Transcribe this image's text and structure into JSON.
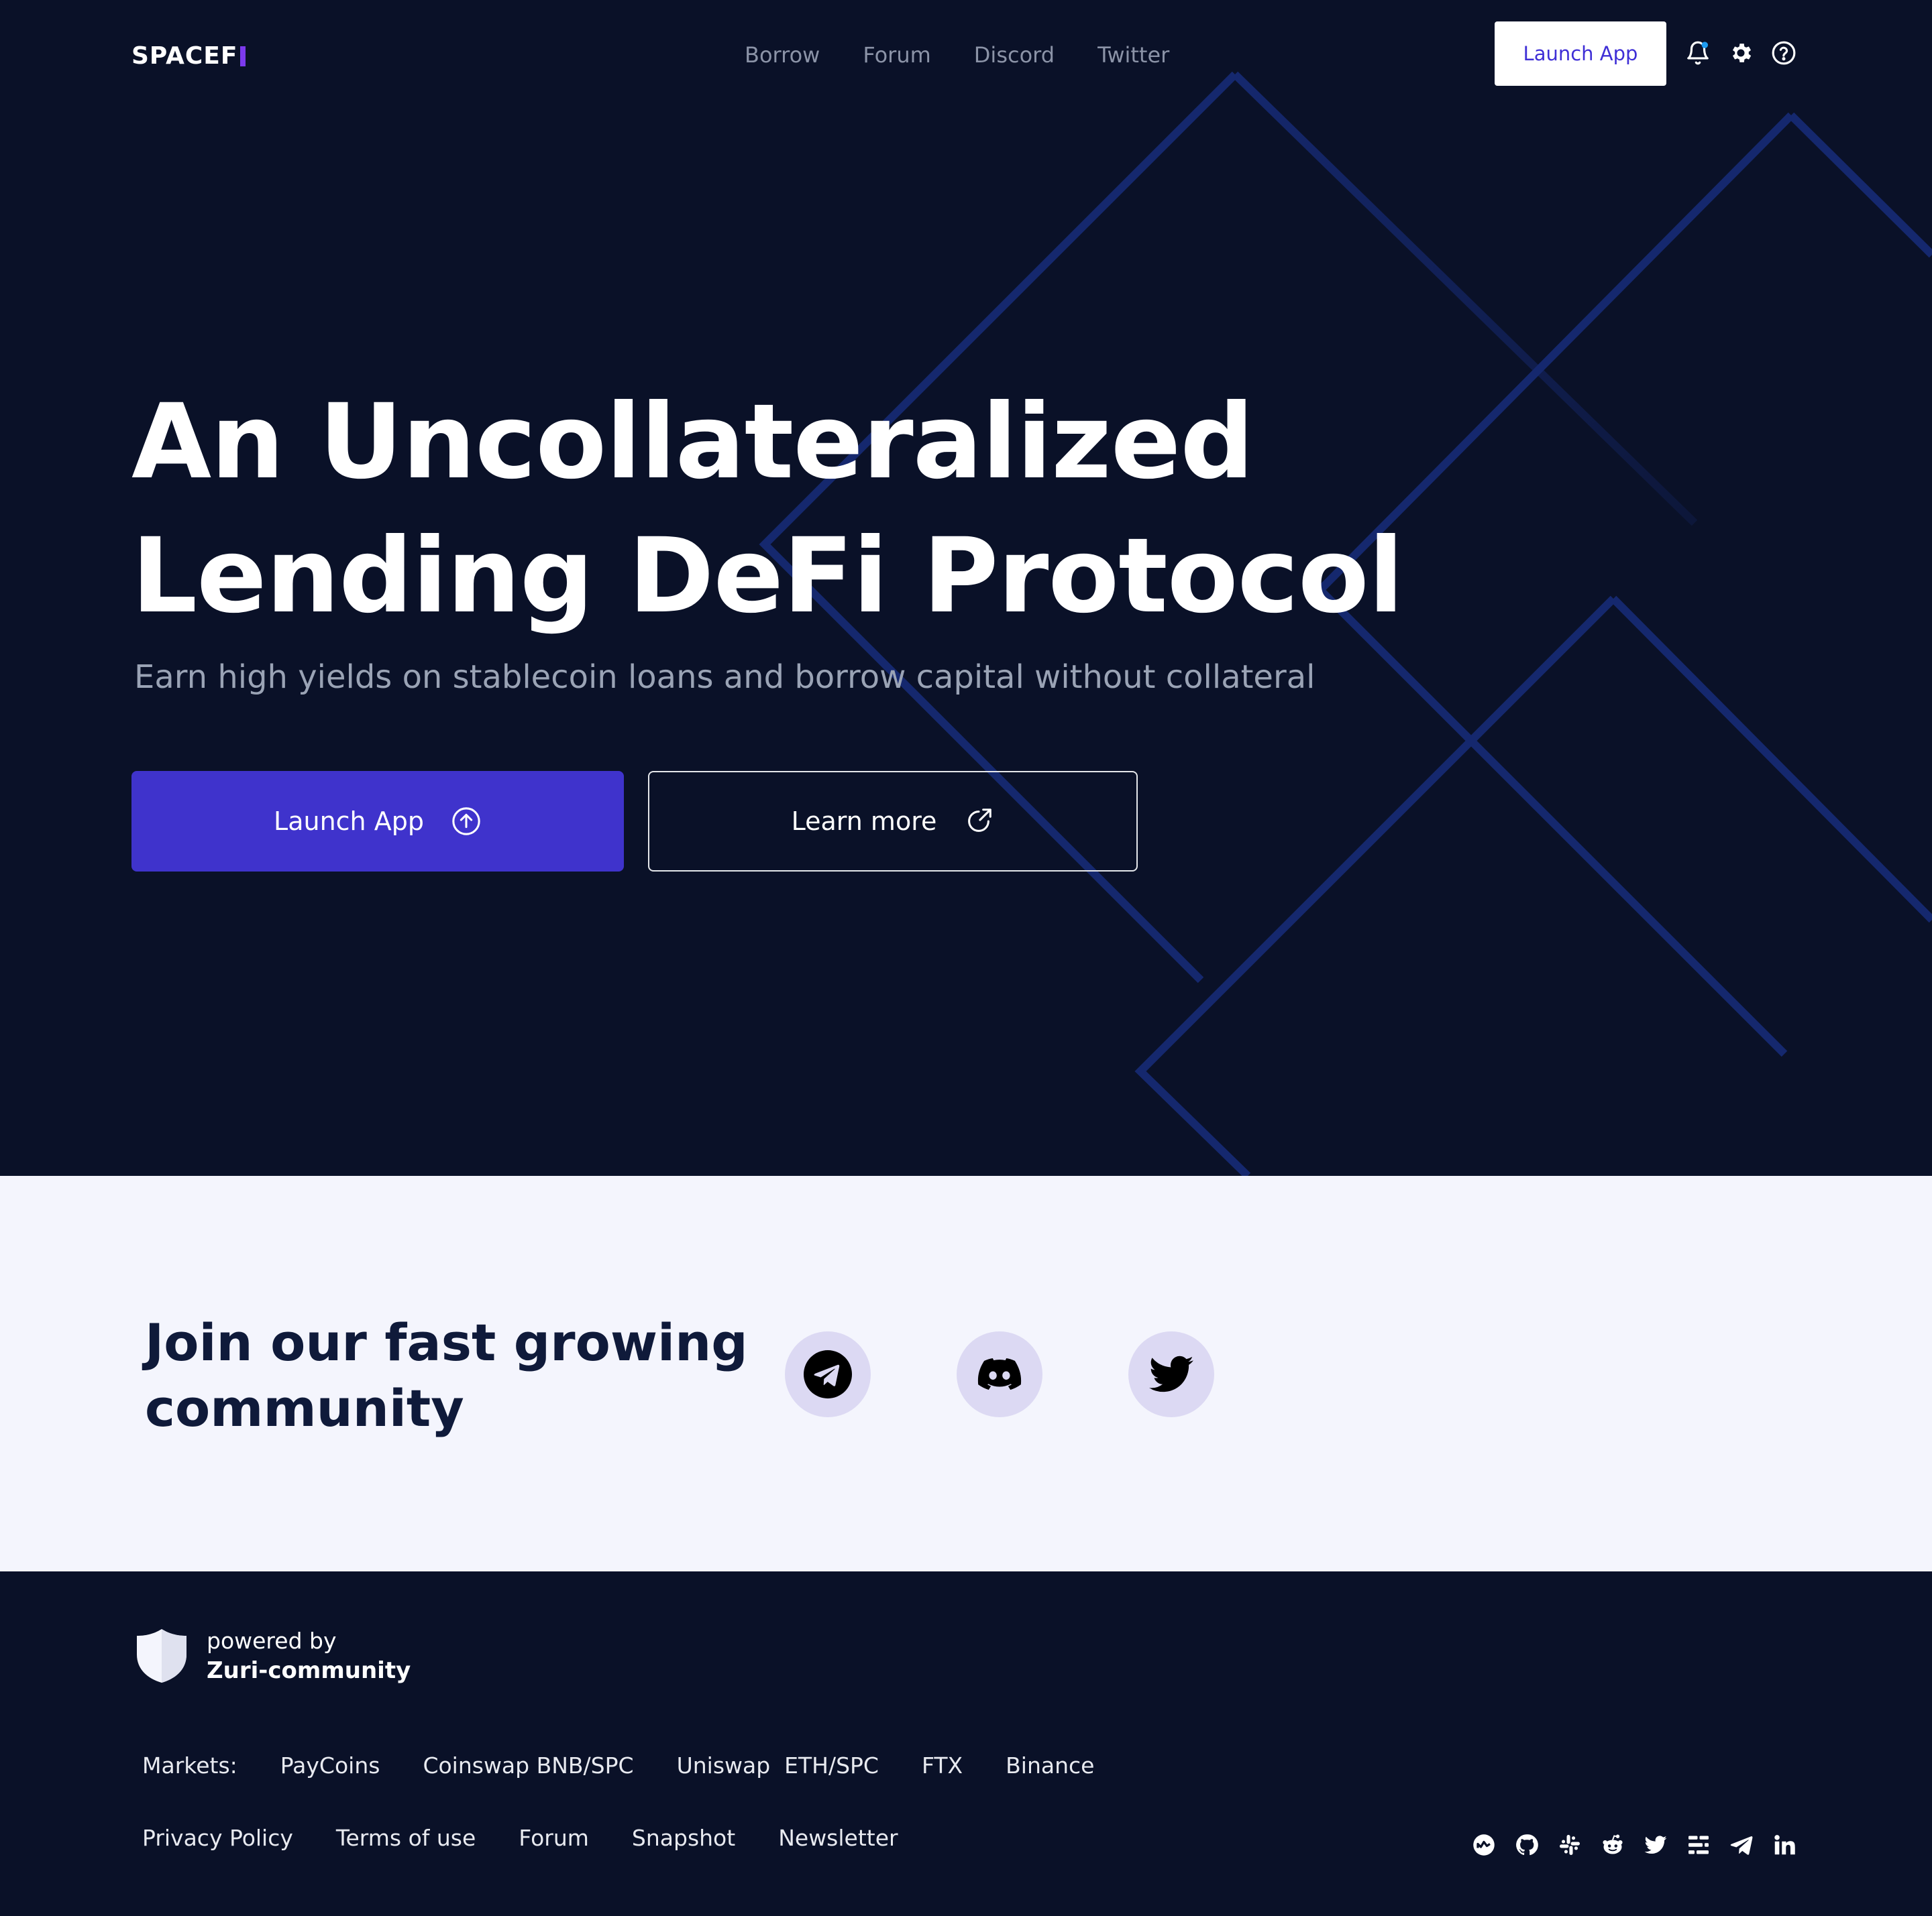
{
  "header": {
    "logo_text": "SPACEF",
    "nav": [
      "Borrow",
      "Forum",
      "Discord",
      "Twitter"
    ],
    "launch_label": "Launch App",
    "icons": [
      "bell-icon",
      "gear-icon",
      "help-icon"
    ],
    "accent_color": "#3f33cc",
    "logo_mark_color": "#7c3aed"
  },
  "hero": {
    "title_line1": "An Uncollateralized",
    "title_line2": "Lending DeFi Protocol",
    "subtitle": "Earn high yields on stablecoin loans and borrow capital without collateral",
    "primary_button": "Launch App",
    "secondary_button": "Learn more",
    "background_color": "#0a1128"
  },
  "community": {
    "title_line1": "Join our fast growing",
    "title_line2": "community",
    "socials": [
      "telegram-icon",
      "discord-icon",
      "twitter-icon"
    ],
    "background_color": "#f4f5fd"
  },
  "footer": {
    "powered_label": "powered by",
    "community_name": "Zuri-community",
    "markets_label": "Markets:",
    "markets": [
      "PayCoins",
      "Coinswap BNB/SPC",
      "Uniswap  ETH/SPC",
      "FTX",
      "Binance"
    ],
    "links": [
      "Privacy Policy",
      "Terms of use",
      "Forum",
      "Snapshot",
      "Newsletter"
    ],
    "social_icons": [
      "coinmarketcap-icon",
      "github-icon",
      "slack-icon",
      "reddit-icon",
      "twitter-icon",
      "medium-icon",
      "telegram-icon",
      "linkedin-icon"
    ]
  }
}
